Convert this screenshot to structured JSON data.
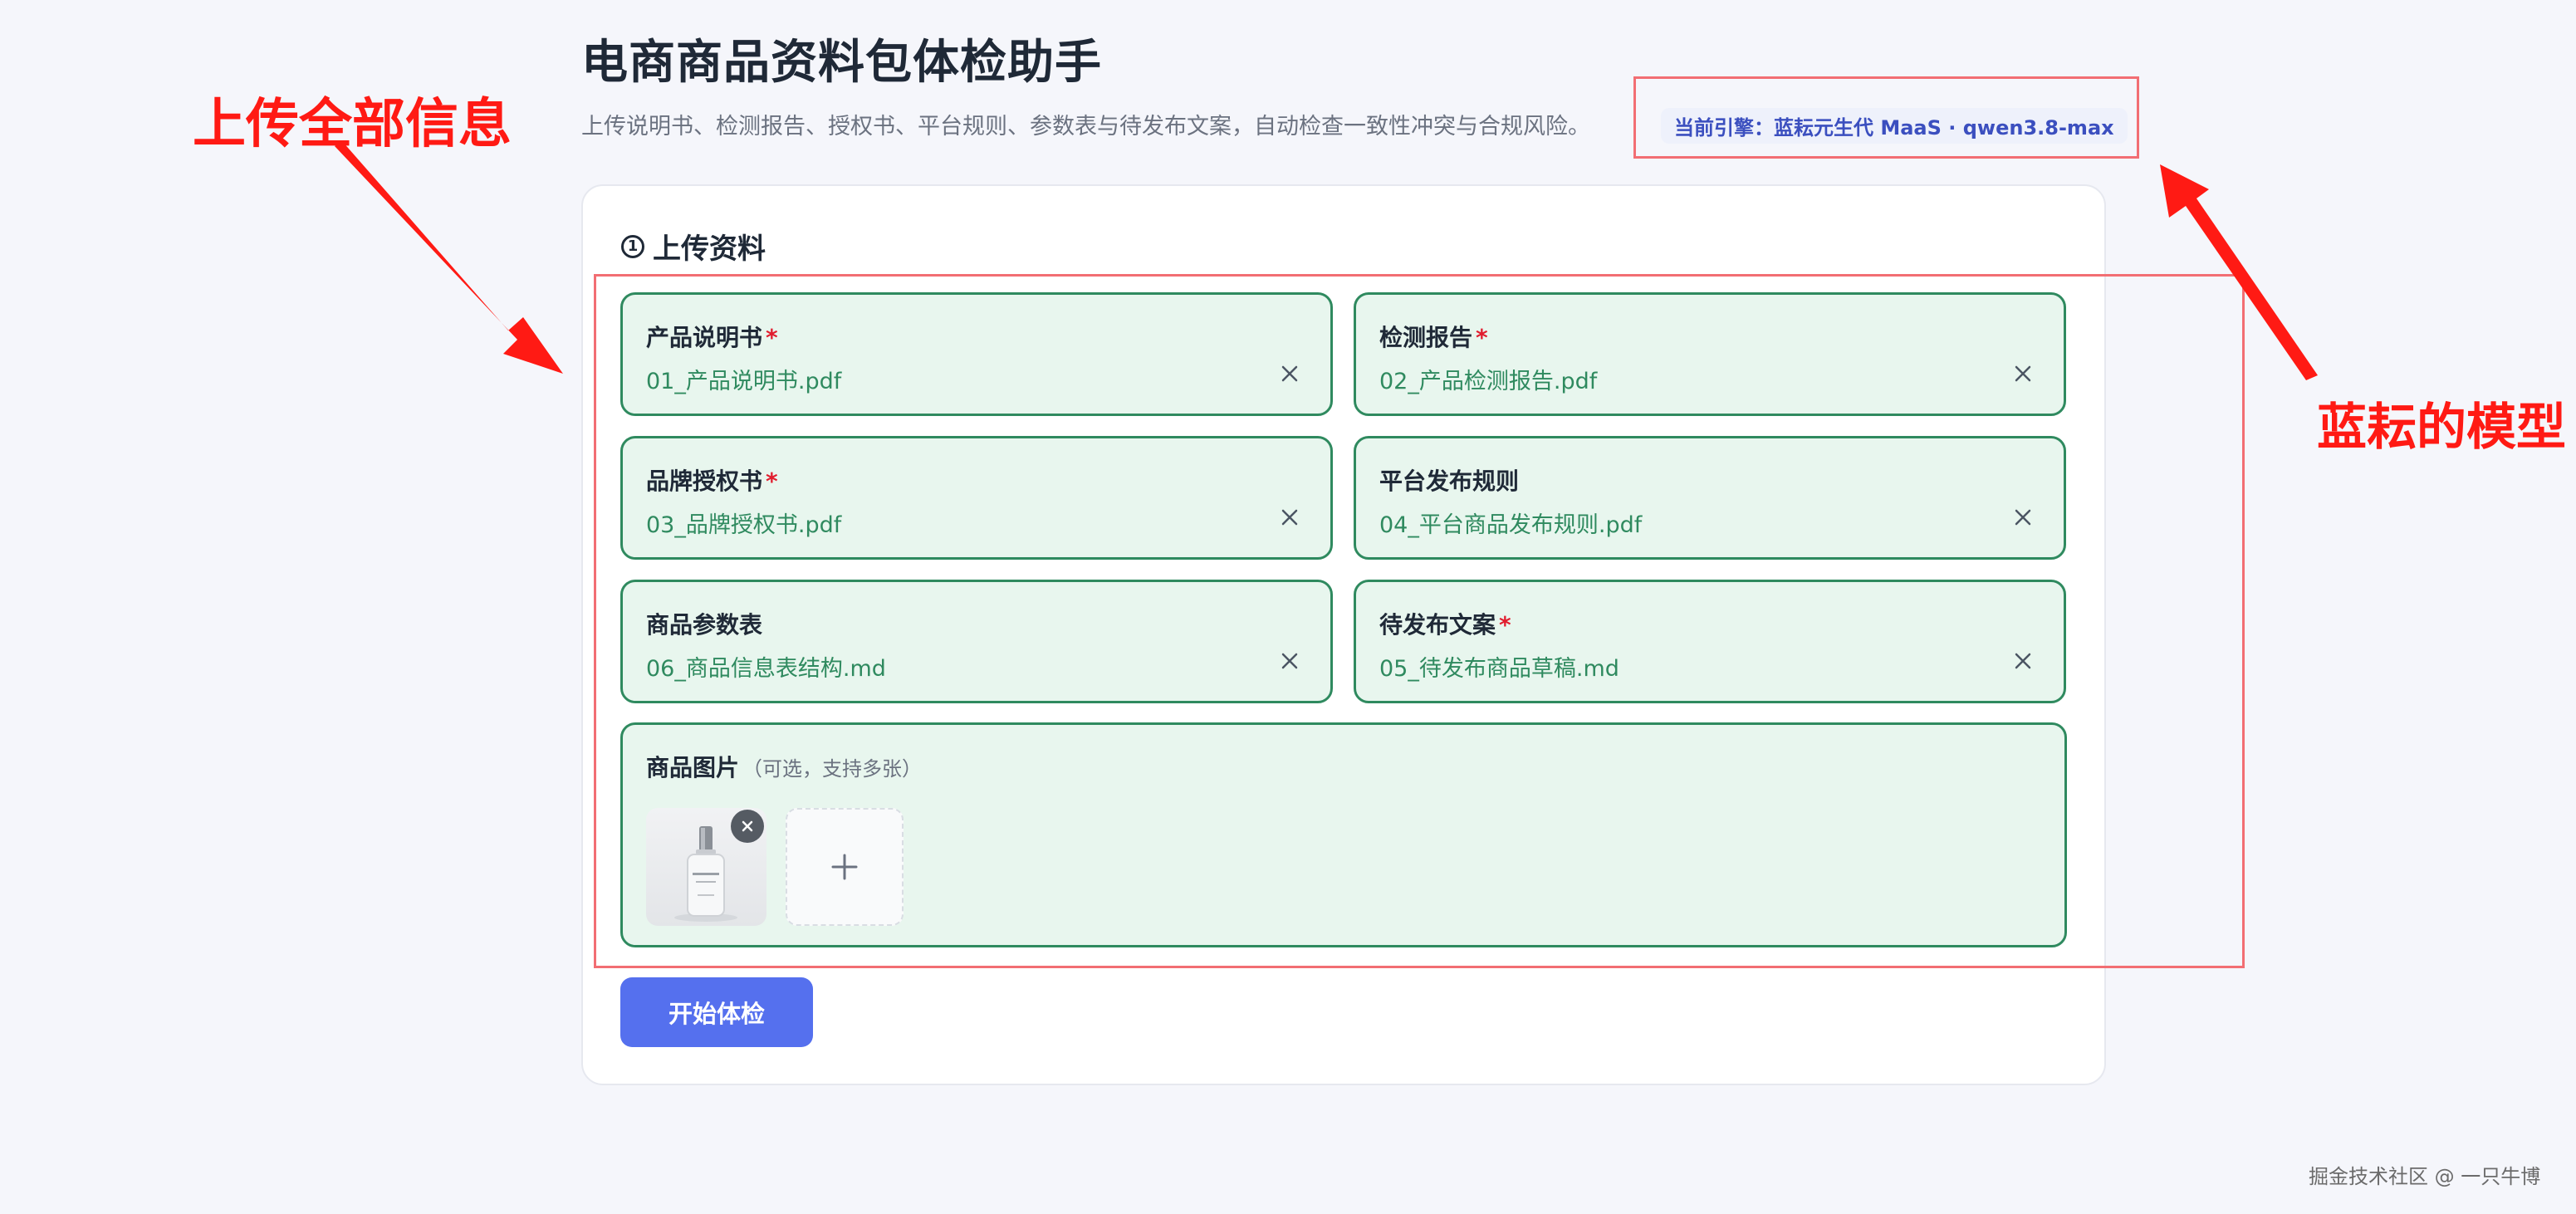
{
  "header": {
    "title": "电商商品资料包体检助手",
    "subtitle": "上传说明书、检测报告、授权书、平台规则、参数表与待发布文案，自动检查一致性冲突与合规风险。",
    "engine_badge": "当前引擎：蓝耘元生代 MaaS · qwen3.8-max"
  },
  "upload_section": {
    "number": "1",
    "title": "上传资料",
    "required_mark": "*",
    "slots": [
      {
        "label": "产品说明书",
        "required": true,
        "filename": "01_产品说明书.pdf"
      },
      {
        "label": "检测报告",
        "required": true,
        "filename": "02_产品检测报告.pdf"
      },
      {
        "label": "品牌授权书",
        "required": true,
        "filename": "03_品牌授权书.pdf"
      },
      {
        "label": "平台发布规则",
        "required": false,
        "filename": "04_平台商品发布规则.pdf"
      },
      {
        "label": "商品参数表",
        "required": false,
        "filename": "06_商品信息表结构.md"
      },
      {
        "label": "待发布文案",
        "required": true,
        "filename": "05_待发布商品草稿.md"
      }
    ],
    "images": {
      "label": "商品图片",
      "hint": "（可选，支持多张）",
      "thumbnail_count": 1
    }
  },
  "start_button": "开始体检",
  "annotations": {
    "left_text": "上传全部信息",
    "right_text": "蓝耘的模型",
    "color": "#ff1a14"
  },
  "watermark": "掘金技术社区 @ 一只牛博",
  "colors": {
    "accent": "#5570ee",
    "success_border": "#2f8a5f",
    "success_bg": "#e8f6ee",
    "required": "#e11d2e",
    "annotation_box": "#f26e73"
  }
}
